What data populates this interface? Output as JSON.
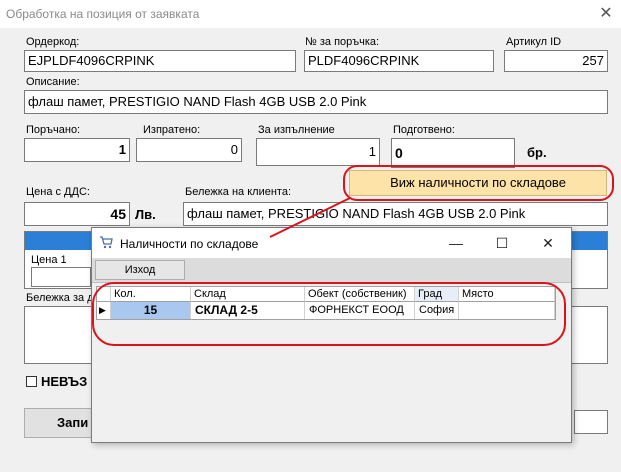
{
  "window": {
    "title": "Обработка на позиция от заявката",
    "close": "✕"
  },
  "fields": {
    "order_code": {
      "label": "Ордеркод:",
      "value": "EJPLDF4096CRPINK"
    },
    "order_number": {
      "label": "№ за поръчка:",
      "value": "PLDF4096CRPINK"
    },
    "article_id": {
      "label": "Артикул ID",
      "value": "257"
    },
    "description": {
      "label": "Описание:",
      "value": "флаш памет, PRESTIGIO NAND Flash 4GB USB 2.0 Pink"
    },
    "ordered": {
      "label": "Поръчано:",
      "value": "1"
    },
    "sent": {
      "label": "Изпратено:",
      "value": "0"
    },
    "to_fulfill": {
      "label": "За изпълнение",
      "value": "1"
    },
    "prepared": {
      "label": "Подготвено:",
      "value": "0"
    },
    "unit": "бр.",
    "price": {
      "label": "Цена с ДДС:",
      "value": "45",
      "currency": "Лв."
    },
    "client_note": {
      "label": "Бележка на клиента:",
      "value": "флаш памет, PRESTIGIO NAND Flash 4GB USB 2.0 Pink"
    },
    "price1_label": "Цена 1",
    "note_label": "Бележка за д",
    "checkbox_label": "НЕВЪЗ",
    "save_button": "Запи"
  },
  "stock_button": "Виж наличности по складове",
  "dialog": {
    "title": "Наличности по складове",
    "minimize": "—",
    "maximize": "☐",
    "close": "✕",
    "exit_button": "Изход",
    "columns": [
      "Кол.",
      "Склад",
      "Обект (собственик)",
      "Град",
      "Място"
    ],
    "rows": [
      {
        "qty": "15",
        "warehouse": "СКЛАД 2-5",
        "owner": "ФОРНЕКСТ ЕООД",
        "city": "София",
        "place": ""
      }
    ],
    "row_pointer": "▶"
  },
  "colors": {
    "accent_blue": "#2b7fd6",
    "selection": "#a9c8ef",
    "highlight_red": "#d9141b",
    "button_peach": "#fde3a7"
  }
}
